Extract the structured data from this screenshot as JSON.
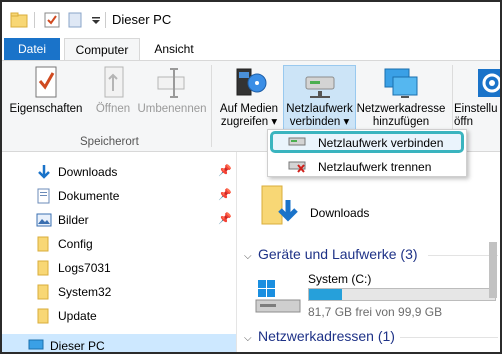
{
  "window": {
    "title": "Dieser PC"
  },
  "ribbon_tabs": {
    "datei": "Datei",
    "computer": "Computer",
    "ansicht": "Ansicht"
  },
  "ribbon": {
    "eigenschaften": "Eigenschaften",
    "oeffnen": "Öffnen",
    "umbenennen": "Umbenennen",
    "group_speicherort": "Speicherort",
    "auf_medien_1": "Auf Medien",
    "auf_medien_2": "zugreifen ▾",
    "netzlaufwerk_1": "Netzlaufwerk",
    "netzlaufwerk_2": "verbinden ▾",
    "netzwerkadresse_1": "Netzwerkadresse",
    "netzwerkadresse_2": "hinzufügen",
    "einstellungen_1": "Einstellu",
    "einstellungen_2": "öffn"
  },
  "dropdown": {
    "item1": "Netzlaufwerk verbinden",
    "item2": "Netzlaufwerk trennen"
  },
  "nav": {
    "items": [
      {
        "label": "Downloads",
        "pinned": true
      },
      {
        "label": "Dokumente",
        "pinned": true
      },
      {
        "label": "Bilder",
        "pinned": true
      },
      {
        "label": "Config",
        "pinned": false
      },
      {
        "label": "Logs7031",
        "pinned": false
      },
      {
        "label": "System32",
        "pinned": false
      },
      {
        "label": "Update",
        "pinned": false
      },
      {
        "label": "Dieser PC",
        "pinned": false
      }
    ]
  },
  "content": {
    "downloads_label": "Downloads",
    "section_devices": "Geräte und Laufwerke (3)",
    "section_network": "Netzwerkadressen (1)",
    "drive_name": "System (C:)",
    "drive_free": "81,7 GB frei von 99,9 GB",
    "drive_used_fraction": 0.18
  },
  "colors": {
    "accent": "#1a73c9",
    "highlight_border": "#3ab4bf",
    "section_text": "#1e3287",
    "drive_bar": "#26a0da"
  }
}
